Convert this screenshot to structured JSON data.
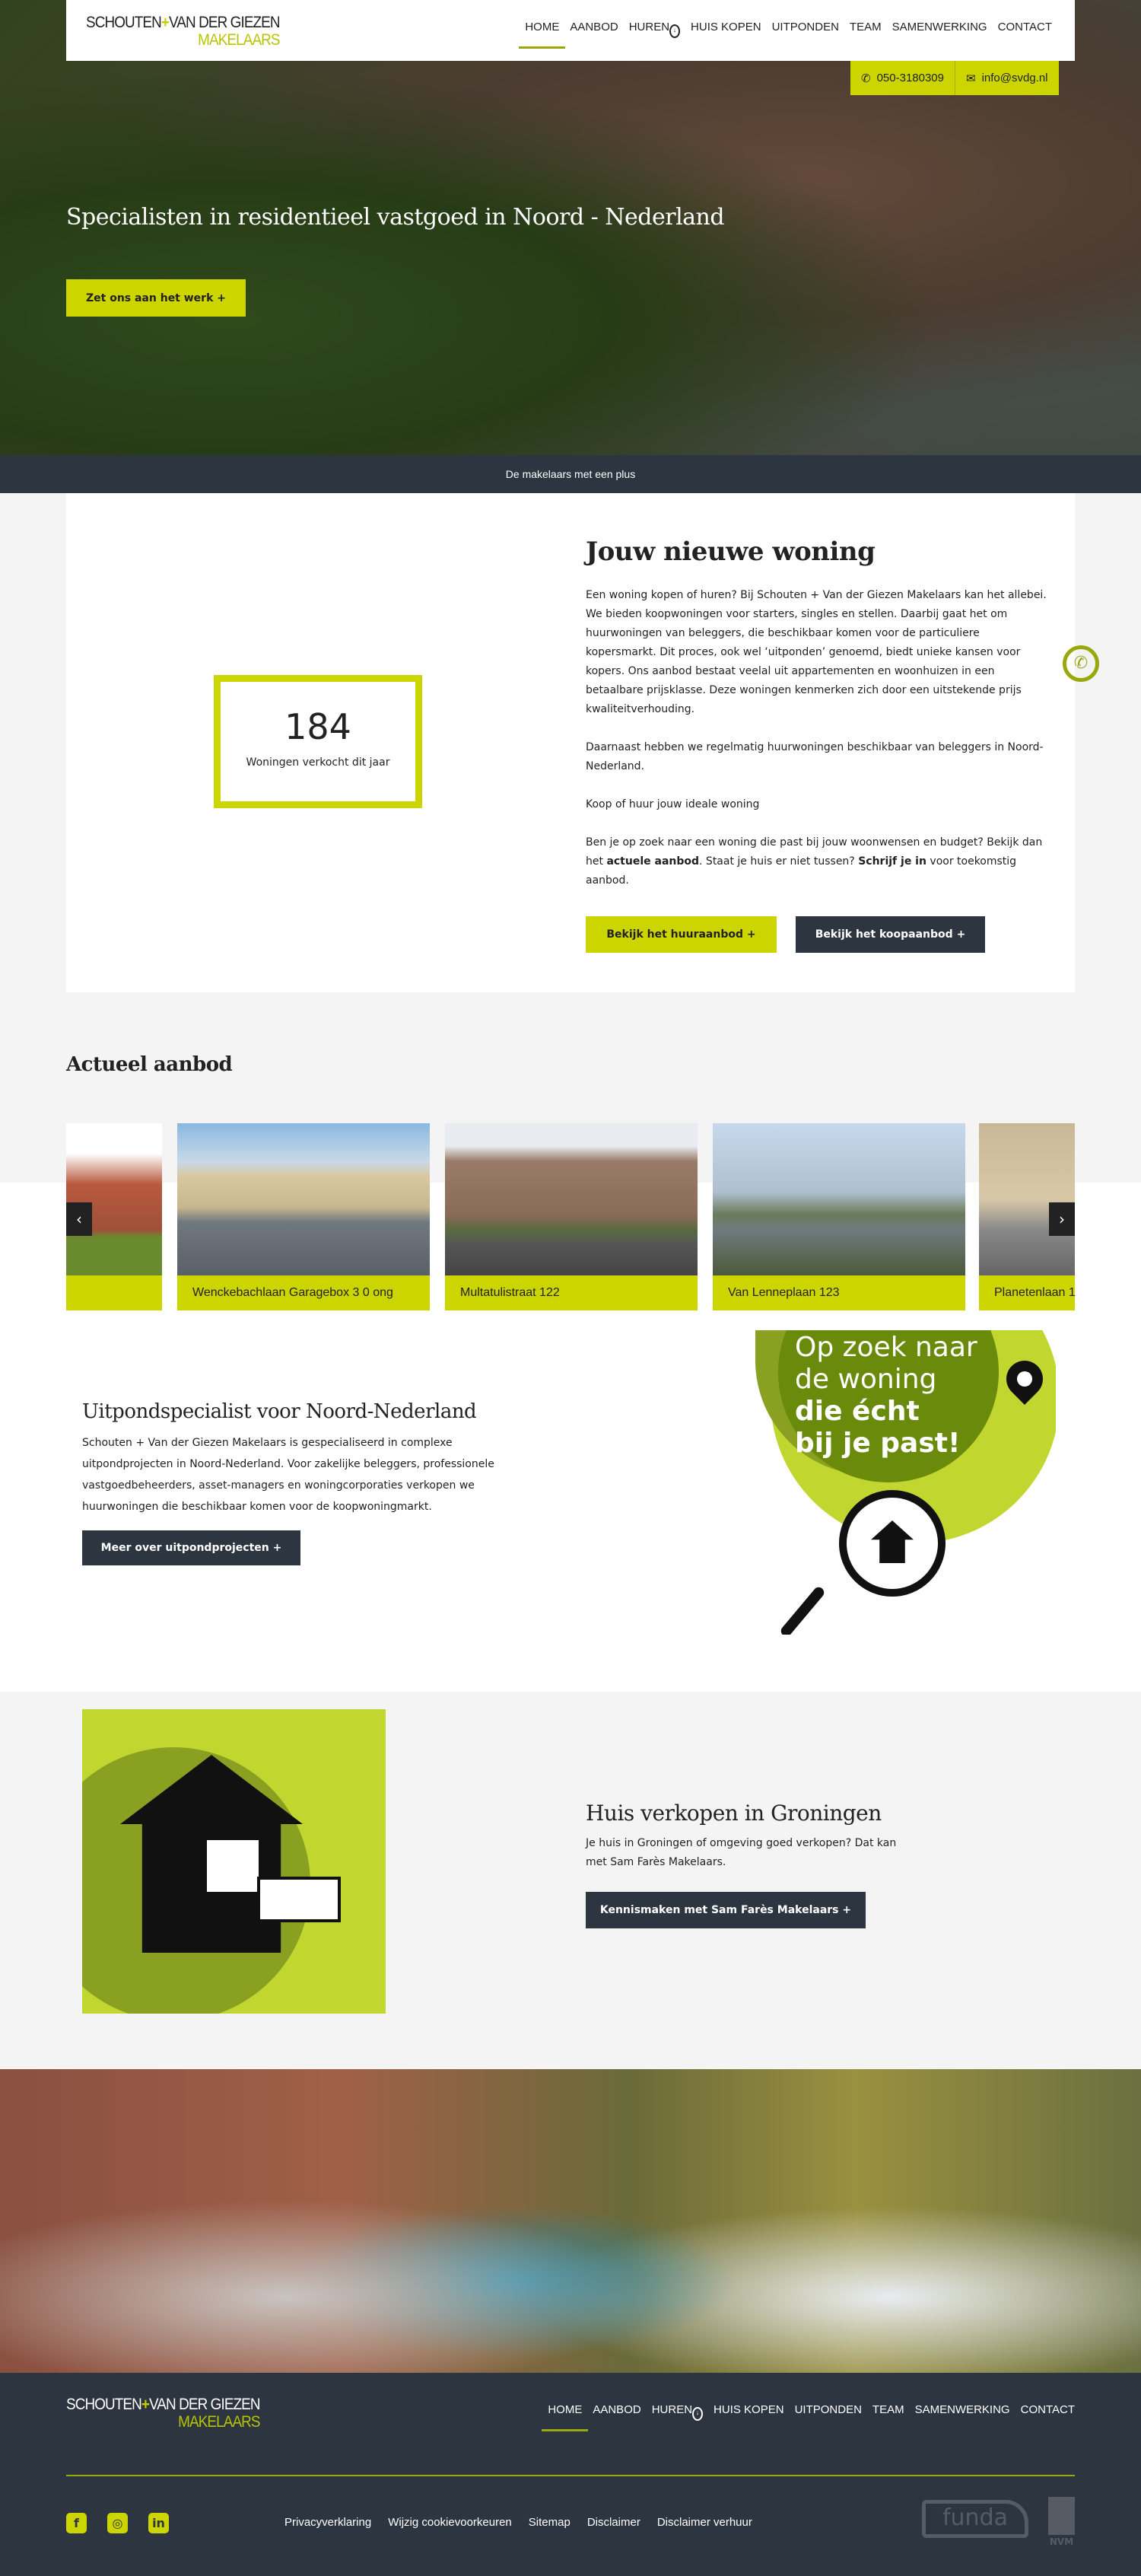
{
  "colors": {
    "accent": "#cdd500",
    "dark": "#2d3540"
  },
  "header": {
    "logo_line1a": "SCHOUTEN",
    "logo_plus": "+",
    "logo_line1b": "VAN DER GIEZEN",
    "logo_line2": "MAKELAARS",
    "nav": [
      "HOME",
      "AANBOD",
      "HUREN",
      "HUIS KOPEN",
      "UITPONDEN",
      "TEAM",
      "SAMENWERKING",
      "CONTACT"
    ],
    "active": "HOME"
  },
  "contact": {
    "phone": "050-3180309",
    "email": "info@svdg.nl"
  },
  "hero": {
    "title": "Specialisten in residentieel vastgoed in Noord - Nederland",
    "button": "Zet ons aan het werk +"
  },
  "band": "De makelaars met een plus",
  "intro": {
    "stat_value": "184",
    "stat_label": "Woningen verkocht dit jaar",
    "title": "Jouw nieuwe woning",
    "p1": "Een woning kopen of huren? Bij Schouten + Van der Giezen Makelaars kan het allebei. We bieden koopwoningen voor starters, singles en stellen. Daarbij gaat het om huurwoningen van beleggers, die beschikbaar komen voor de particuliere kopersmarkt. Dit proces, ook wel ‘uitponden’ genoemd, biedt unieke kansen voor kopers.  Ons aanbod bestaat veelal uit appartementen en woonhuizen in een betaalbare prijsklasse. Deze woningen kenmerken zich door een uitstekende prijs kwaliteitverhouding.",
    "p2": "Daarnaast hebben we regelmatig huurwoningen beschikbaar van beleggers in Noord-Nederland.",
    "p3": "Koop of huur jouw ideale woning",
    "p4a": "Ben je op zoek naar een woning die past bij jouw woonwensen en budget? Bekijk dan het ",
    "p4_link1": "actuele aanbod",
    "p4b": ". Staat je huis er niet tussen? ",
    "p4_link2": "Schrijf je in",
    "p4c": " voor toekomstig aanbod.",
    "btn_huur": "Bekijk het huuraanbod +",
    "btn_koop": "Bekijk het koopaanbod +"
  },
  "aanbod": {
    "title": "Actueel aanbod",
    "items": [
      "",
      "Wenckebachlaan Garagebox 3 0 ong",
      "Multatulistraat 122",
      "Van Lenneplaan 123",
      "Planetenlaan 1"
    ]
  },
  "uitpond": {
    "title": "Uitpondspecialist voor Noord-Nederland",
    "text": "Schouten + Van der Giezen Makelaars is gespecialiseerd in complexe uitpondprojecten in Noord-Nederland. Voor zakelijke beleggers, professionele vastgoedbeheerders, asset-managers en woningcorporaties verkopen we huurwoningen die beschikbaar komen voor de koopwoningmarkt.",
    "button": "Meer over uitpondprojecten +",
    "illus_l1": "Op zoek naar",
    "illus_l2": "de woning",
    "illus_l3": "die écht",
    "illus_l4": "bij je past!"
  },
  "verkopen": {
    "title": "Huis verkopen in Groningen",
    "text": "Je huis in Groningen of omgeving goed verkopen? Dat kan met Sam Farès Makelaars.",
    "button": "Kennismaken met Sam Farès Makelaars +"
  },
  "footer": {
    "links": [
      "Privacyverklaring",
      "Wijzig cookievoorkeuren",
      "Sitemap",
      "Disclaimer",
      "Disclaimer verhuur"
    ],
    "funda": "funda",
    "nvm": "NVM"
  }
}
